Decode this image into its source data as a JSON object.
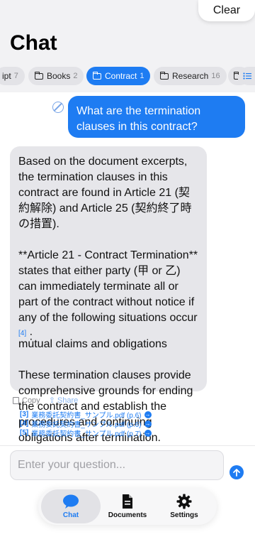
{
  "header": {
    "clear_label": "Clear",
    "title": "Chat"
  },
  "folders": [
    {
      "label": "ipt",
      "count": "7",
      "active": false
    },
    {
      "label": "Books",
      "count": "2",
      "active": false
    },
    {
      "label": "Contract",
      "count": "1",
      "active": true
    },
    {
      "label": "Research",
      "count": "16",
      "active": false
    }
  ],
  "user_message": "What are the termination clauses in this contract?",
  "assistant_message": {
    "para1": "Based on the document excerpts, the termination clauses in this contract are found in Article 21 (契約解除) and Article 25 (契約終了時の措置).",
    "para2_main": "**Article 21 - Contract Termination** states that either party (甲 or 乙) can immediately terminate all or part of the contract without notice if any of the following situations occur",
    "para2_cite": "[4]",
    "para2_end": ":",
    "overlap_line": "mutual claims and obligations",
    "para3": "These termination clauses provide comprehensive grounds for ending the contract and establish the procedures and continuing obligations after termination."
  },
  "actions": {
    "copy_label": "Copy",
    "share_label": "Share"
  },
  "citations": [
    {
      "num": "[3]",
      "file": "業務委託契約書_サンプル.pdf (p.6)"
    },
    {
      "num": "[4]",
      "file": "業務委託契約書_サンプル.pdf (p.6)"
    },
    {
      "num": "[5]",
      "file": "業務委託契約書_サンプル.pdf (p.7)"
    }
  ],
  "input": {
    "placeholder": "Enter your question..."
  },
  "tabs": [
    {
      "label": "Chat",
      "active": true
    },
    {
      "label": "Documents",
      "active": false
    },
    {
      "label": "Settings",
      "active": false
    }
  ],
  "colors": {
    "accent": "#1e7cf2",
    "bubble_gray": "#e6e6ea"
  }
}
